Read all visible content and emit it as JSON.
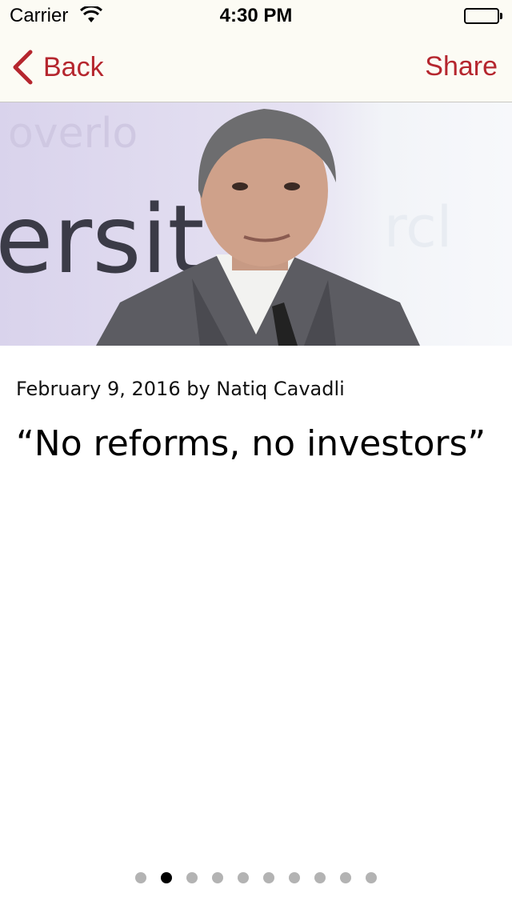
{
  "status_bar": {
    "carrier": "Carrier",
    "time": "4:30 PM"
  },
  "nav": {
    "back_label": "Back",
    "share_label": "Share",
    "accent_color": "#b5262e"
  },
  "hero": {
    "background_text": "ersit"
  },
  "article": {
    "byline": "February 9, 2016 by Natiq Cavadli",
    "title": "“No reforms, no investors”"
  },
  "pager": {
    "total": 10,
    "current_index": 1
  }
}
